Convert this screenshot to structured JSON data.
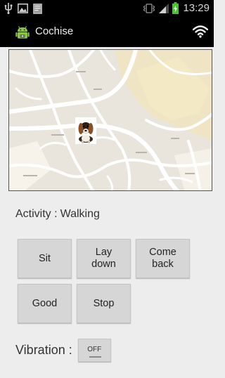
{
  "status_bar": {
    "time": "13:29",
    "icons": [
      "usb-icon",
      "image-icon",
      "document-icon",
      "vibrate-icon",
      "signal-icon",
      "battery-charging-icon"
    ]
  },
  "action_bar": {
    "title": "Cochise",
    "app_icon": "android-icon",
    "action_icon": "wifi-icon"
  },
  "map": {
    "marker_icon": "dog-icon"
  },
  "activity": {
    "label": "Activity :",
    "value": "Walking"
  },
  "commands": {
    "sit": "Sit",
    "lay_down": "Lay\ndown",
    "come_back": "Come\nback",
    "good": "Good",
    "stop": "Stop"
  },
  "vibration": {
    "label": "Vibration :",
    "toggle_state": "OFF"
  }
}
